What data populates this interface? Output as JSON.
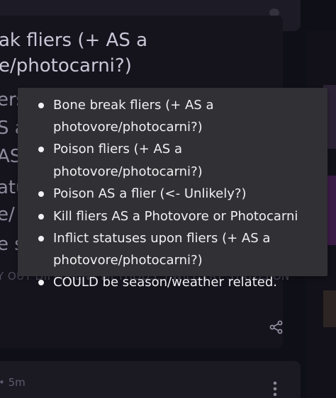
{
  "background": {
    "post_title_line1": "ak fliers (+ AS a",
    "post_title_line2": "e/photocarni?)",
    "frag1": "ers",
    "frag2": "S a",
    "frag3": "AS",
    "frag4": "atu",
    "frag5": "e/",
    "frag6": "e s",
    "meta_line": "Y OUT DIFFERENT METHODS, I WILL TRY STATUS ON",
    "bottom_meta": "• 5m"
  },
  "tooltip": {
    "items": [
      {
        "text": "Bone break fliers (+ AS a photovore/photocarni?)"
      },
      {
        "text": "Poison fliers (+ AS a photovore/photocarni?)"
      },
      {
        "text": "Poison AS a flier (<- Unlikely?)"
      },
      {
        "text": "Kill fliers AS a Photovore or Photocarni"
      },
      {
        "text": "Inflict statuses upon fliers (+ AS a photovore/photocarni?)"
      },
      {
        "text": "COULD be season/weather related."
      }
    ]
  },
  "icons": {
    "share": "share-icon",
    "more": "kebab-menu-icon"
  },
  "colors": {
    "tooltip_bg": "#313034",
    "tooltip_text": "#f1f0f3",
    "page_bg": "#0f0f17"
  }
}
